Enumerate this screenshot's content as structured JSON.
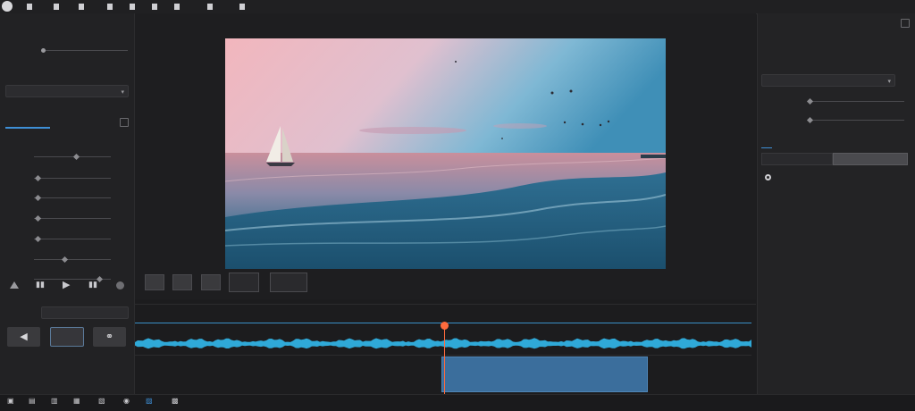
{
  "topbar": {
    "items": [
      "",
      "",
      "",
      "",
      "",
      "",
      "",
      "",
      ""
    ]
  },
  "left": {
    "row1_label": "",
    "row2_label": "",
    "row2_value": "",
    "dropdown_value": "",
    "section_title": "",
    "sliders": [
      {
        "label": "",
        "value": "",
        "level": 0.55
      },
      {
        "label": "",
        "value": "",
        "level": 0.05
      },
      {
        "label": "",
        "value": "",
        "level": 0.05
      },
      {
        "label": "",
        "value": "",
        "level": 0.05
      },
      {
        "label": "",
        "value": "",
        "level": 0.05
      },
      {
        "label": "",
        "value": "",
        "level": 0.4
      },
      {
        "label": "",
        "value": "",
        "level": 0.85
      }
    ],
    "bottom_label": "",
    "bottom_field": "",
    "btn_prev": "◀",
    "btn_mid": "",
    "btn_link": "⚭"
  },
  "center": {
    "controls": [
      "",
      "",
      "",
      "",
      ""
    ],
    "control_icons": [
      "",
      "",
      "",
      "",
      "",
      ""
    ]
  },
  "timeline": {
    "header_left": "",
    "header_right": "",
    "clip_label": ""
  },
  "right": {
    "title": "",
    "header_a": "",
    "header_b": "",
    "section": "",
    "dropdown_value": "",
    "slider_a_label": "",
    "slider_b_label": "",
    "tab_a": "",
    "tab_b": "",
    "seg_a": "",
    "seg_b": "",
    "radio_label": ""
  },
  "colors": {
    "accent": "#3e8fd6",
    "playhead": "#ff6b3d",
    "waveform": "#2fa9d8",
    "clip": "#3b6e9c"
  }
}
